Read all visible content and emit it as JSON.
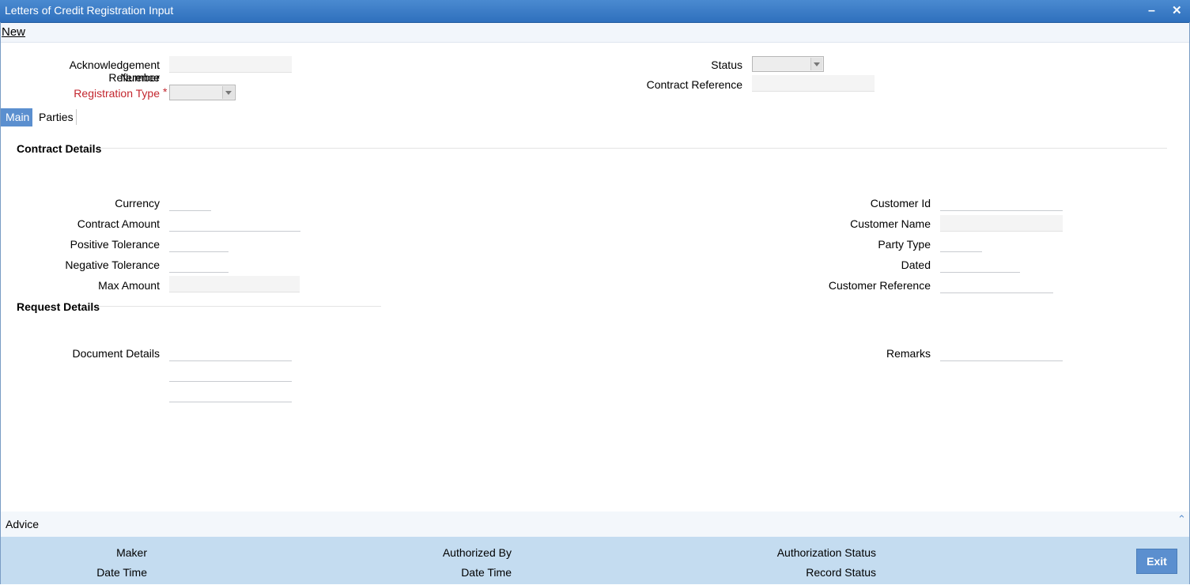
{
  "window": {
    "title": "Letters of Credit Registration Input",
    "minimize_glyph": "–",
    "close_glyph": "✕"
  },
  "menu": {
    "new_label": "New"
  },
  "header": {
    "ack_ref_label_line1": "Acknowledgement Reference",
    "ack_ref_label_line2": "Number",
    "ack_ref_value": "",
    "registration_type_label": "Registration Type",
    "required_marker": "*",
    "registration_type_value": "",
    "status_label": "Status",
    "status_value": "",
    "contract_reference_label": "Contract Reference",
    "contract_reference_value": ""
  },
  "tabs": [
    {
      "label": "Main",
      "active": true
    },
    {
      "label": "Parties",
      "active": false
    }
  ],
  "contract_details": {
    "title": "Contract Details",
    "currency_label": "Currency",
    "currency_value": "",
    "contract_amount_label": "Contract Amount",
    "contract_amount_value": "",
    "positive_tolerance_label": "Positive Tolerance",
    "positive_tolerance_value": "",
    "negative_tolerance_label": "Negative Tolerance",
    "negative_tolerance_value": "",
    "max_amount_label": "Max Amount",
    "max_amount_value": "",
    "customer_id_label": "Customer Id",
    "customer_id_value": "",
    "customer_name_label": "Customer Name",
    "customer_name_value": "",
    "party_type_label": "Party Type",
    "party_type_value": "",
    "dated_label": "Dated",
    "dated_value": "",
    "customer_reference_label": "Customer Reference",
    "customer_reference_value": ""
  },
  "request_details": {
    "title": "Request Details",
    "document_details_label": "Document Details",
    "document_details_values": [
      "",
      "",
      ""
    ],
    "remarks_label": "Remarks",
    "remarks_value": ""
  },
  "advice": {
    "label": "Advice",
    "collapse_glyph": "⌃"
  },
  "footer": {
    "maker_label": "Maker",
    "maker_date_time_label": "Date Time",
    "authorized_by_label": "Authorized By",
    "authorized_date_time_label": "Date Time",
    "authorization_status_label": "Authorization Status",
    "record_status_label": "Record Status",
    "exit_label": "Exit"
  },
  "colors": {
    "titlebar": "#3a7cc6",
    "accent": "#5b8fcf",
    "footer": "#c4dcf0",
    "required": "#c3262e"
  }
}
